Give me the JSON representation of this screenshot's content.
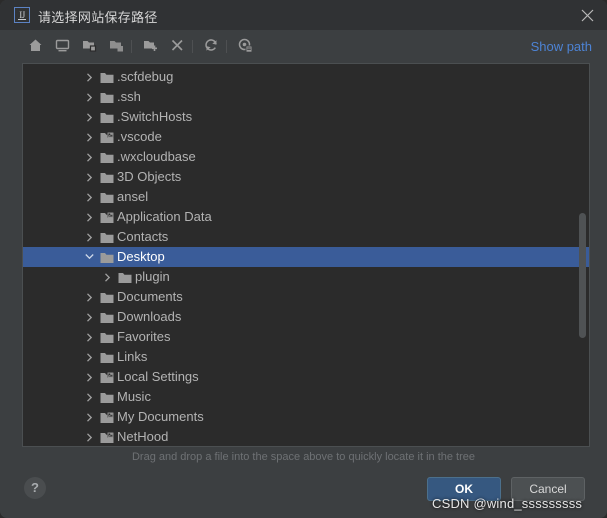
{
  "window": {
    "title": "请选择网站保存路径",
    "app_icon": "intellij-idea-icon",
    "icon_text": "IJ",
    "close_icon": "close-icon"
  },
  "toolbar": {
    "buttons": [
      {
        "name": "home-icon",
        "tooltip": "Home"
      },
      {
        "name": "desktop-icon",
        "tooltip": "Desktop"
      },
      {
        "name": "expand-all-icon",
        "tooltip": "Expand All"
      },
      {
        "name": "collapse-all-icon",
        "tooltip": "Collapse All"
      },
      {
        "name": "new-folder-icon",
        "tooltip": "New Folder"
      },
      {
        "name": "delete-icon",
        "tooltip": "Delete"
      },
      {
        "name": "refresh-icon",
        "tooltip": "Refresh"
      },
      {
        "name": "show-hidden-files-icon",
        "tooltip": "Show Hidden Files"
      }
    ],
    "show_path_label": "Show path"
  },
  "tree": {
    "rows": [
      {
        "label": ".scfdebug",
        "indent": 1,
        "expanded": false,
        "icon": "folder-icon",
        "selected": false
      },
      {
        "label": ".ssh",
        "indent": 1,
        "expanded": false,
        "icon": "folder-icon",
        "selected": false
      },
      {
        "label": ".SwitchHosts",
        "indent": 1,
        "expanded": false,
        "icon": "folder-icon",
        "selected": false
      },
      {
        "label": ".vscode",
        "indent": 1,
        "expanded": false,
        "icon": "folder-shortcut-icon",
        "selected": false
      },
      {
        "label": ".wxcloudbase",
        "indent": 1,
        "expanded": false,
        "icon": "folder-icon",
        "selected": false
      },
      {
        "label": "3D Objects",
        "indent": 1,
        "expanded": false,
        "icon": "folder-icon",
        "selected": false
      },
      {
        "label": "ansel",
        "indent": 1,
        "expanded": false,
        "icon": "folder-icon",
        "selected": false
      },
      {
        "label": "Application Data",
        "indent": 1,
        "expanded": false,
        "icon": "folder-shortcut-icon",
        "selected": false
      },
      {
        "label": "Contacts",
        "indent": 1,
        "expanded": false,
        "icon": "folder-icon",
        "selected": false
      },
      {
        "label": "Desktop",
        "indent": 1,
        "expanded": true,
        "icon": "folder-icon",
        "selected": true
      },
      {
        "label": "plugin",
        "indent": 2,
        "expanded": false,
        "icon": "folder-icon",
        "selected": false
      },
      {
        "label": "Documents",
        "indent": 1,
        "expanded": false,
        "icon": "folder-icon",
        "selected": false
      },
      {
        "label": "Downloads",
        "indent": 1,
        "expanded": false,
        "icon": "folder-icon",
        "selected": false
      },
      {
        "label": "Favorites",
        "indent": 1,
        "expanded": false,
        "icon": "folder-icon",
        "selected": false
      },
      {
        "label": "Links",
        "indent": 1,
        "expanded": false,
        "icon": "folder-icon",
        "selected": false
      },
      {
        "label": "Local Settings",
        "indent": 1,
        "expanded": false,
        "icon": "folder-shortcut-icon",
        "selected": false
      },
      {
        "label": "Music",
        "indent": 1,
        "expanded": false,
        "icon": "folder-icon",
        "selected": false
      },
      {
        "label": "My Documents",
        "indent": 1,
        "expanded": false,
        "icon": "folder-shortcut-icon",
        "selected": false
      },
      {
        "label": "NetHood",
        "indent": 1,
        "expanded": false,
        "icon": "folder-shortcut-icon",
        "selected": false
      }
    ],
    "scrollbar": "vertical-scrollbar"
  },
  "hint": "Drag and drop a file into the space above to quickly locate it in the tree",
  "footer": {
    "help_label": "?",
    "ok_label": "OK",
    "cancel_label": "Cancel"
  },
  "watermark": "CSDN @wind_sssssssss",
  "colors": {
    "dialog_bg": "#3c3f41",
    "titlebar_bg": "#303234",
    "panel_bg": "#2b2b2b",
    "selection": "#3a5c99",
    "link": "#4d83d4",
    "ok_button": "#365880",
    "folder": "#9b9b9b",
    "text": "#b3b3b3"
  }
}
